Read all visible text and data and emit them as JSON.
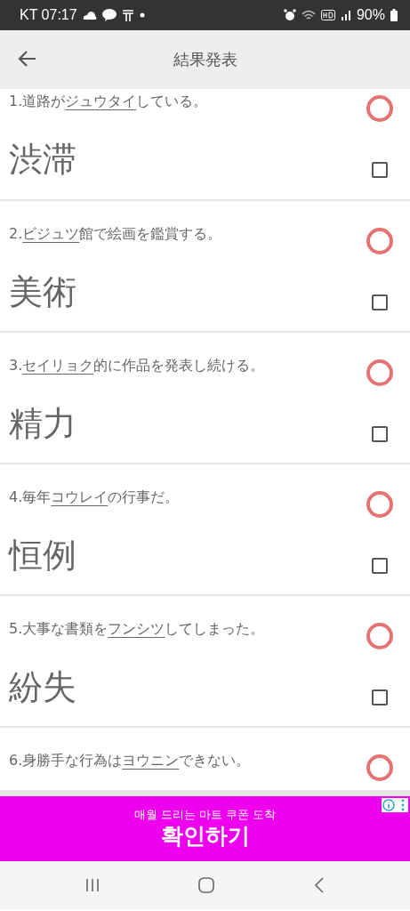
{
  "status_bar": {
    "carrier_time": "KT 07:17",
    "battery": "90%"
  },
  "app_bar": {
    "title": "結果発表"
  },
  "questions": [
    {
      "number": "1.",
      "before": "道路が",
      "underlined": "ジュウタイ",
      "after": "している。",
      "answer": "渋滞",
      "correct": true,
      "checked": false
    },
    {
      "number": "2.",
      "underlined": "ビジュツ",
      "after": "館で絵画を鑑賞する。",
      "answer": "美術",
      "correct": true,
      "checked": false
    },
    {
      "number": "3.",
      "underlined": "セイリョク",
      "after": "的に作品を発表し続ける。",
      "answer": "精力",
      "correct": true,
      "checked": false
    },
    {
      "number": "4.",
      "before": "毎年",
      "underlined": "コウレイ",
      "after": "の行事だ。",
      "answer": "恒例",
      "correct": true,
      "checked": false
    },
    {
      "number": "5.",
      "before": "大事な書類を",
      "underlined": "フンシツ",
      "after": "してしまった。",
      "answer": "紛失",
      "correct": true,
      "checked": false
    },
    {
      "number": "6.",
      "before": "身勝手な行為は",
      "underlined": "ヨウニン",
      "after": "できない。",
      "correct": true
    }
  ],
  "ad": {
    "subtitle": "매월 드리는 마트 쿠폰 도착",
    "headline": "확인하기"
  }
}
